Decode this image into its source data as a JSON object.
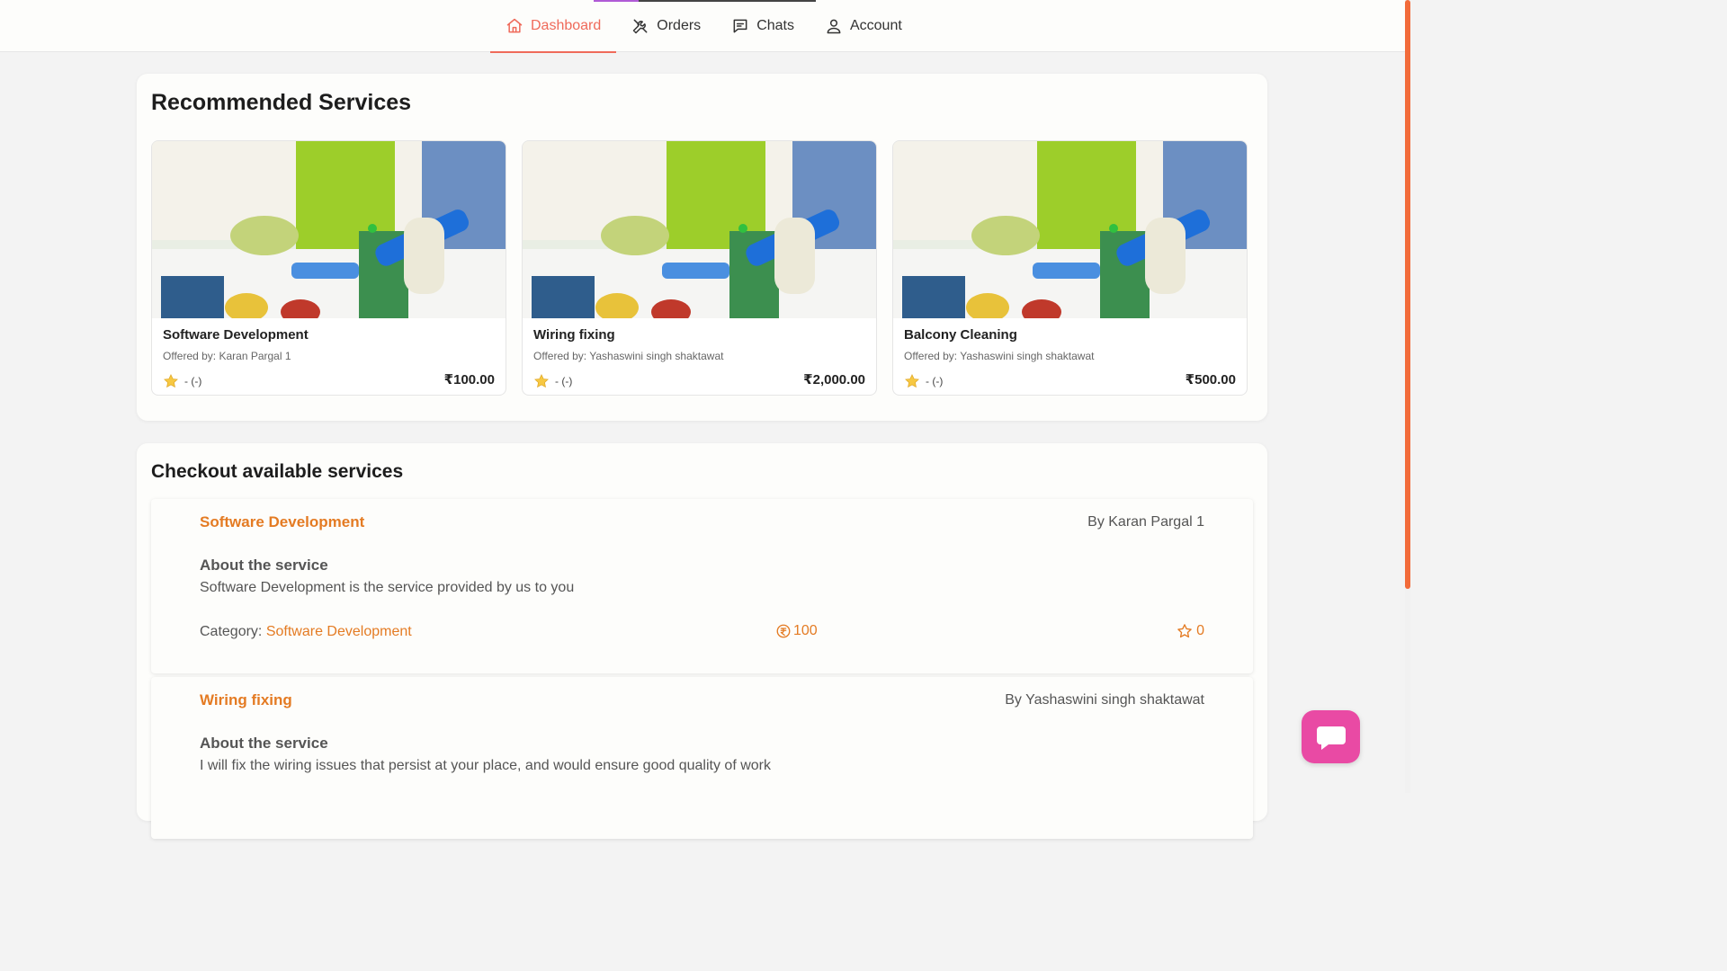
{
  "nav": {
    "items": [
      {
        "label": "Dashboard",
        "icon": "home-icon",
        "active": true
      },
      {
        "label": "Orders",
        "icon": "tools-icon",
        "active": false
      },
      {
        "label": "Chats",
        "icon": "chat-icon",
        "active": false
      },
      {
        "label": "Account",
        "icon": "user-icon",
        "active": false
      }
    ]
  },
  "recommended": {
    "heading": "Recommended Services",
    "cards": [
      {
        "title": "Software Development",
        "offered_by": "Offered by: Karan Pargal 1",
        "rating": "- (-)",
        "price": "₹100.00"
      },
      {
        "title": "Wiring fixing",
        "offered_by": "Offered by: Yashaswini singh shaktawat",
        "rating": "- (-)",
        "price": "₹2,000.00"
      },
      {
        "title": "Balcony Cleaning",
        "offered_by": "Offered by: Yashaswini singh shaktawat",
        "rating": "- (-)",
        "price": "₹500.00"
      }
    ]
  },
  "available": {
    "heading": "Checkout available services",
    "services": [
      {
        "name": "Software Development",
        "by": "By Karan Pargal 1",
        "about_label": "About the service",
        "description": "Software Development is the service provided by us to you",
        "category_label": "Category:",
        "category": "Software Development",
        "amount": "100",
        "rating": "0"
      },
      {
        "name": "Wiring fixing",
        "by": "By Yashaswini singh shaktawat",
        "about_label": "About the service",
        "description": "I will fix the wiring issues that persist at your place, and would ensure good quality of work"
      }
    ]
  },
  "colors": {
    "accent": "#ef6a5a",
    "orange": "#e47b23",
    "chat_button": "#e94aa4"
  }
}
